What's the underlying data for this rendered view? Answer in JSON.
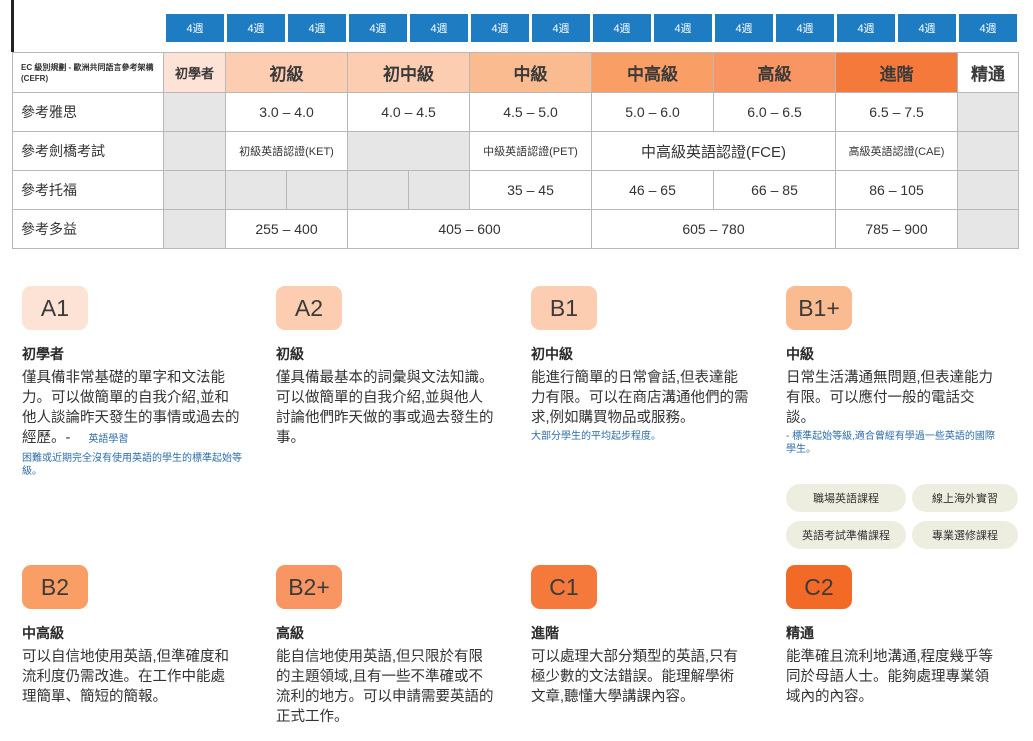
{
  "weeks": [
    "4週",
    "4週",
    "4週",
    "4週",
    "4週",
    "4週",
    "4週",
    "4週",
    "4週",
    "4週",
    "4週",
    "4週",
    "4週",
    "4週"
  ],
  "table": {
    "framework_label": "EC 級別規劃 - 歐洲共同語言參考架構 (CEFR)",
    "levels": [
      "初學者",
      "初級",
      "初中級",
      "中級",
      "中高級",
      "高級",
      "進階",
      "精通"
    ],
    "level_colors": [
      "#fde2d6",
      "#fccdb0",
      "#fccdb0",
      "#fbbb90",
      "#f99e65",
      "#f89562",
      "#f4793a",
      "#ffffff"
    ],
    "rows": {
      "ielts": {
        "label": "參考雅思",
        "values": [
          "3.0 – 4.0",
          "4.0 – 4.5",
          "4.5 – 5.0",
          "5.0 – 6.0",
          "6.0 – 6.5",
          "6.5 – 7.5"
        ]
      },
      "cambridge": {
        "label": "參考劍橋考試",
        "values": [
          "初級英語認證(KET)",
          "中級英語認證(PET)",
          "中高級英語認證(FCE)",
          "高級英語認證(CAE)"
        ]
      },
      "toefl": {
        "label": "參考托福",
        "values": [
          "35 – 45",
          "46 – 65",
          "66 – 85",
          "86 – 105"
        ]
      },
      "toeic": {
        "label": "參考多益",
        "values": [
          "255 – 400",
          "405 – 600",
          "605 – 780",
          "785 – 900"
        ]
      }
    }
  },
  "cards": [
    {
      "code": "A1",
      "title": "初學者",
      "desc": "僅具備非常基礎的單字和文法能力。可以做簡單的自我介紹,並和他人談論昨天發生的事情或過去的經歷。-",
      "note_inline": "英語學習",
      "note": "困難或近期完全沒有使用英語的學生的標準起始等級。",
      "color": "#fde2d6"
    },
    {
      "code": "A2",
      "title": "初級",
      "desc": "僅具備最基本的詞彙與文法知識。可以做簡單的自我介紹,並與他人討論他們昨天做的事或過去發生的事。",
      "note": "",
      "color": "#fccdb0"
    },
    {
      "code": "B1",
      "title": "初中級",
      "desc": "能進行簡單的日常會話,但表達能力有限。可以在商店溝通他們的需求,例如購買物品或服務。",
      "note": "大部分學生的平均起步程度。",
      "color": "#fccdb0"
    },
    {
      "code": "B1+",
      "title": "中級",
      "desc": "日常生活溝通無問題,但表達能力有限。可以應付一般的電話交談。",
      "note": "- 標準起始等級,適合曾經有學過一些英語的國際學生。",
      "color": "#fbbb90"
    },
    {
      "code": "B2",
      "title": "中高級",
      "desc": "可以自信地使用英語,但準確度和流利度仍需改進。在工作中能處理簡單、簡短的簡報。",
      "note": "",
      "color": "#f99e65"
    },
    {
      "code": "B2+",
      "title": "高級",
      "desc": "能自信地使用英語,但只限於有限的主題領域,且有一些不準確或不流利的地方。可以申請需要英語的正式工作。",
      "note": "",
      "color": "#f89562"
    },
    {
      "code": "C1",
      "title": "進階",
      "desc": "可以處理大部分類型的英語,只有極少數的文法錯誤。能理解學術文章,聽懂大學講課內容。",
      "note": "",
      "color": "#f4793a"
    },
    {
      "code": "C2",
      "title": "精通",
      "desc": "能準確且流利地溝通,程度幾乎等同於母語人士。能夠處理專業領域內的內容。",
      "note": "",
      "color": "#f26a25"
    }
  ],
  "courses": [
    "職場英語課程",
    "線上海外實習",
    "英語考試準備課程",
    "專業選修課程"
  ]
}
